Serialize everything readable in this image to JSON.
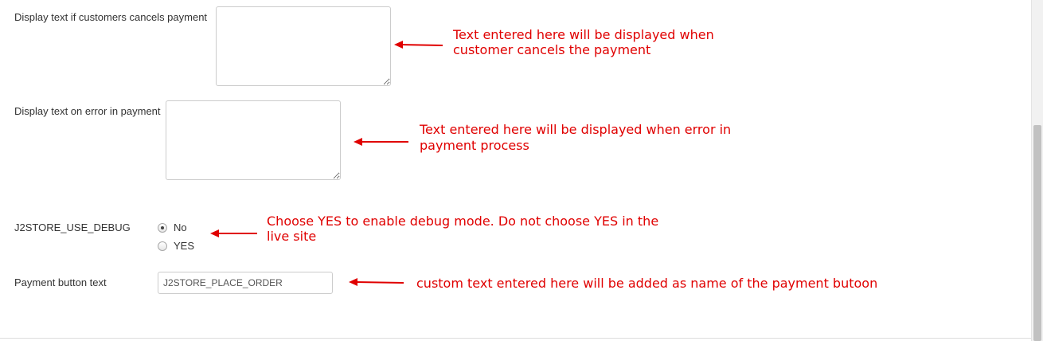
{
  "form": {
    "cancel_text": {
      "label": "Display text if customers cancels payment",
      "value": ""
    },
    "error_text": {
      "label": "Display text on error in payment",
      "value": ""
    },
    "debug": {
      "label": "J2STORE_USE_DEBUG",
      "options": [
        "No",
        "YES"
      ],
      "selected": "No"
    },
    "button_text": {
      "label": "Payment button text",
      "value": "J2STORE_PLACE_ORDER"
    }
  },
  "annotations": {
    "cancel_line1": "Text entered here will be displayed when",
    "cancel_line2": "customer cancels the payment",
    "error_line1": "Text entered here will be displayed when error in",
    "error_line2": "payment process",
    "debug_line1": "Choose YES to enable debug mode. Do not choose YES in the",
    "debug_line2": "live site",
    "button_line1": "custom text entered here will be added as name of the payment butoon"
  },
  "colors": {
    "annotation": "#e00000",
    "border": "#cccccc"
  }
}
